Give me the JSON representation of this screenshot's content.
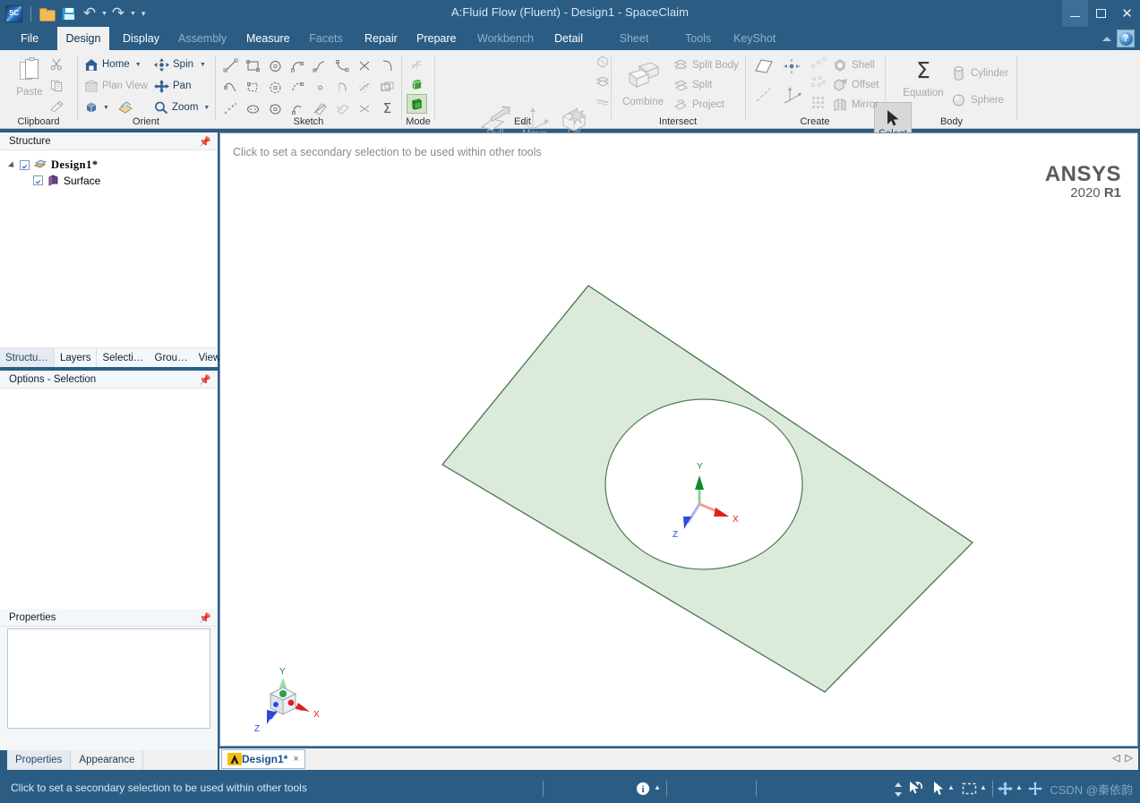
{
  "window": {
    "title": "A:Fluid Flow (Fluent) - Design1 - SpaceClaim",
    "minimize_label": "–",
    "maximize_label": "□",
    "close_label": "✕",
    "help_label": "?"
  },
  "quick_access": {
    "app_logo": "spaceclaim-logo",
    "items": [
      {
        "name": "open-file-icon",
        "label": "Open"
      },
      {
        "name": "save-icon",
        "label": "Save"
      },
      {
        "name": "undo-icon",
        "label": "Undo"
      },
      {
        "name": "redo-icon",
        "label": "Redo"
      },
      {
        "name": "customize-qat-icon",
        "label": "Customize Quick Access Toolbar"
      }
    ]
  },
  "menu": {
    "tabs": [
      {
        "label": "File",
        "state": "normal"
      },
      {
        "label": "Design",
        "state": "active"
      },
      {
        "label": "Display",
        "state": "normal"
      },
      {
        "label": "Assembly",
        "state": "disabled"
      },
      {
        "label": "Measure",
        "state": "normal"
      },
      {
        "label": "Facets",
        "state": "disabled"
      },
      {
        "label": "Repair",
        "state": "normal"
      },
      {
        "label": "Prepare",
        "state": "normal"
      },
      {
        "label": "Workbench",
        "state": "disabled"
      },
      {
        "label": "Detail",
        "state": "normal"
      },
      {
        "label": "Sheet Metal",
        "state": "disabled"
      },
      {
        "label": "Tools",
        "state": "disabled"
      },
      {
        "label": "KeyShot",
        "state": "disabled"
      }
    ]
  },
  "ribbon": {
    "groups": [
      {
        "name": "clipboard",
        "label": "Clipboard"
      },
      {
        "name": "orient",
        "label": "Orient"
      },
      {
        "name": "sketch",
        "label": "Sketch"
      },
      {
        "name": "mode",
        "label": "Mode"
      },
      {
        "name": "edit",
        "label": "Edit"
      },
      {
        "name": "intersect",
        "label": "Intersect"
      },
      {
        "name": "create",
        "label": "Create"
      },
      {
        "name": "body",
        "label": "Body"
      }
    ],
    "clipboard": {
      "paste": "Paste",
      "cut": "Cut",
      "copy": "Copy",
      "format_painter": "Format Painter"
    },
    "orient": {
      "home": "Home",
      "plan_view": "Plan View",
      "spin": "Spin",
      "pan": "Pan",
      "zoom": "Zoom",
      "view_cube": "view-cube",
      "view_sheet": "view-sheet"
    },
    "edit": {
      "select": "Select",
      "pull": "Pull",
      "move": "Move",
      "fill": "Fill"
    },
    "intersect": {
      "combine": "Combine",
      "split_body": "Split Body",
      "split": "Split",
      "project": "Project"
    },
    "create": {
      "shell": "Shell",
      "offset": "Offset",
      "mirror": "Mirror"
    },
    "body": {
      "equation": "Equation",
      "cylinder": "Cylinder",
      "sphere": "Sphere"
    }
  },
  "structure": {
    "panel_title": "Structure",
    "root": "Design1*",
    "child": "Surface",
    "tabs": [
      "Structu…",
      "Layers",
      "Selecti…",
      "Grou…",
      "Views"
    ]
  },
  "options": {
    "panel_title": "Options - Selection"
  },
  "properties": {
    "panel_title": "Properties",
    "tabs": [
      "Properties",
      "Appearance"
    ]
  },
  "viewport": {
    "hint": "Click to set a secondary selection to be used within other tools",
    "logo_top": "ANSYS",
    "logo_year": "2020",
    "logo_release": "R1",
    "axes": {
      "x": "X",
      "y": "Y",
      "z": "Z"
    },
    "mini_axes": {
      "x": "X",
      "y": "Y",
      "z": "Z"
    },
    "surface_fill": "#dceadb",
    "surface_edge": "#4f7a55"
  },
  "document_tabs": {
    "tabs": [
      {
        "label": "Design1*",
        "close": "×"
      }
    ],
    "nav_prev": "◁",
    "nav_next": "▷"
  },
  "statusbar": {
    "message": "Click to set a secondary selection to be used within other tools",
    "info_icon": "info-icon",
    "tools": [
      {
        "name": "spinner-icon"
      },
      {
        "name": "undo-select-icon"
      },
      {
        "name": "cursor-icon"
      },
      {
        "name": "box-select-icon"
      },
      {
        "name": "move-handle-icon"
      },
      {
        "name": "snap-icon"
      }
    ],
    "watermark": "CSDN @秦依韵"
  }
}
